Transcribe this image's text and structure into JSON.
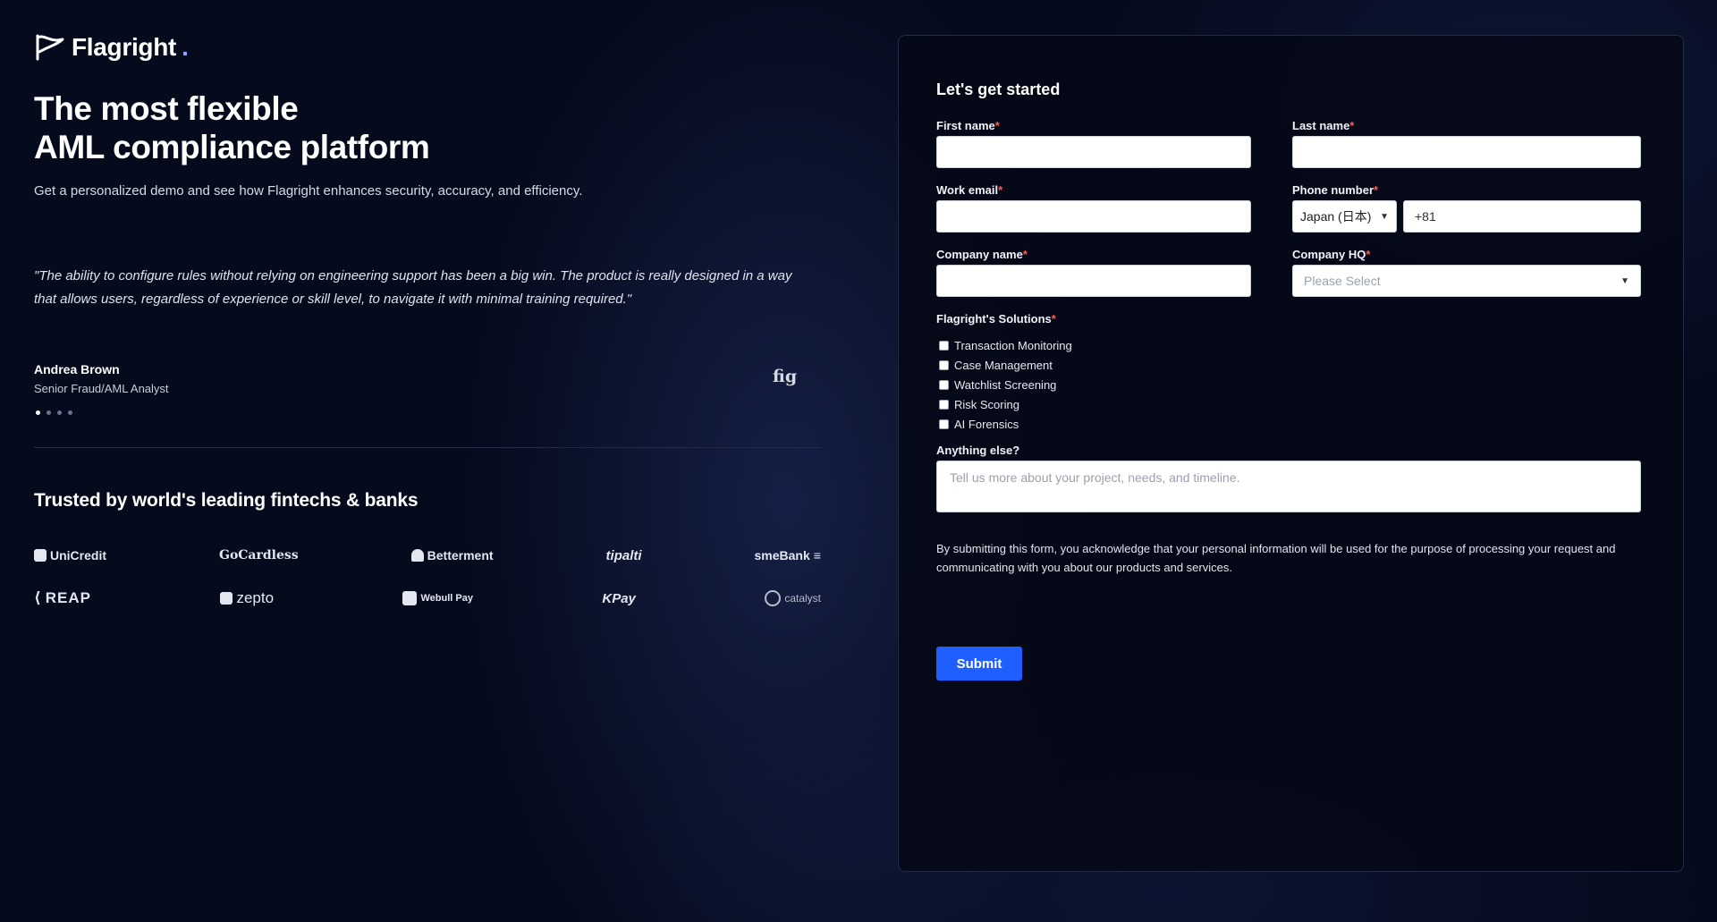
{
  "brand": {
    "name": "Flagright",
    "dot": "."
  },
  "hero": {
    "headline_line1": "The most flexible",
    "headline_line2": "AML compliance platform",
    "subhead": "Get a personalized demo and see how Flagright enhances security, accuracy, and efficiency."
  },
  "testimonial": {
    "quote": "\"The ability to configure rules without relying on engineering support has been a big win. The product is really designed in a way that allows users, regardless of experience or skill level, to navigate it with minimal training required.\"",
    "author_name": "Andrea Brown",
    "author_title": "Senior Fraud/AML Analyst",
    "company_logo": "fig",
    "carousel_total": 4,
    "carousel_active": 1
  },
  "trusted": {
    "heading": "Trusted by world's leading fintechs & banks",
    "row1": [
      "UniCredit",
      "GoCardless",
      "Betterment",
      "tipalti",
      "smeBank"
    ],
    "row2": [
      "REAP",
      "zepto",
      "Webull Pay",
      "KPay",
      "catalyst"
    ]
  },
  "form": {
    "title": "Let's get started",
    "first_name_label": "First name",
    "last_name_label": "Last name",
    "work_email_label": "Work email",
    "phone_label": "Phone number",
    "phone_country": "Japan (日本)",
    "phone_value": "+81",
    "company_name_label": "Company name",
    "company_hq_label": "Company HQ",
    "company_hq_placeholder": "Please Select",
    "solutions_label": "Flagright's Solutions",
    "solutions": [
      "Transaction Monitoring",
      "Case Management",
      "Watchlist Screening",
      "Risk Scoring",
      "AI Forensics"
    ],
    "anything_else_label": "Anything else?",
    "anything_else_placeholder": "Tell us more about your project, needs, and timeline.",
    "notice": "By submitting this form, you acknowledge that your personal information will be used for the purpose of processing your request and communicating with you about our products and services.",
    "submit_label": "Submit",
    "required_mark": "*"
  },
  "colors": {
    "background": "#050a1c",
    "accent": "#1f5fff",
    "required": "#ff5a5a"
  }
}
